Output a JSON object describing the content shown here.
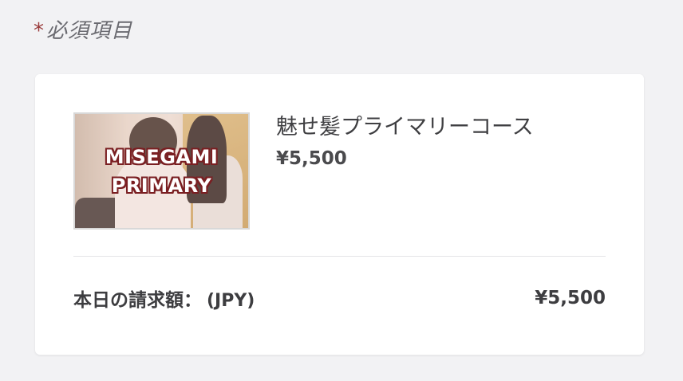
{
  "required_note": {
    "asterisk": "*",
    "text": "必須項目"
  },
  "product": {
    "image_overlay_line1": "MISEGAMI",
    "image_overlay_line2": "PRIMARY",
    "name": "魅せ髪プライマリーコース",
    "price": "¥5,500"
  },
  "total": {
    "label": "本日の請求額：",
    "currency": "(JPY)",
    "value": "¥5,500"
  },
  "colors": {
    "background": "#f2f2f4",
    "card": "#ffffff",
    "asterisk": "#9a3b3b",
    "overlay_outline": "#7a1f22"
  }
}
